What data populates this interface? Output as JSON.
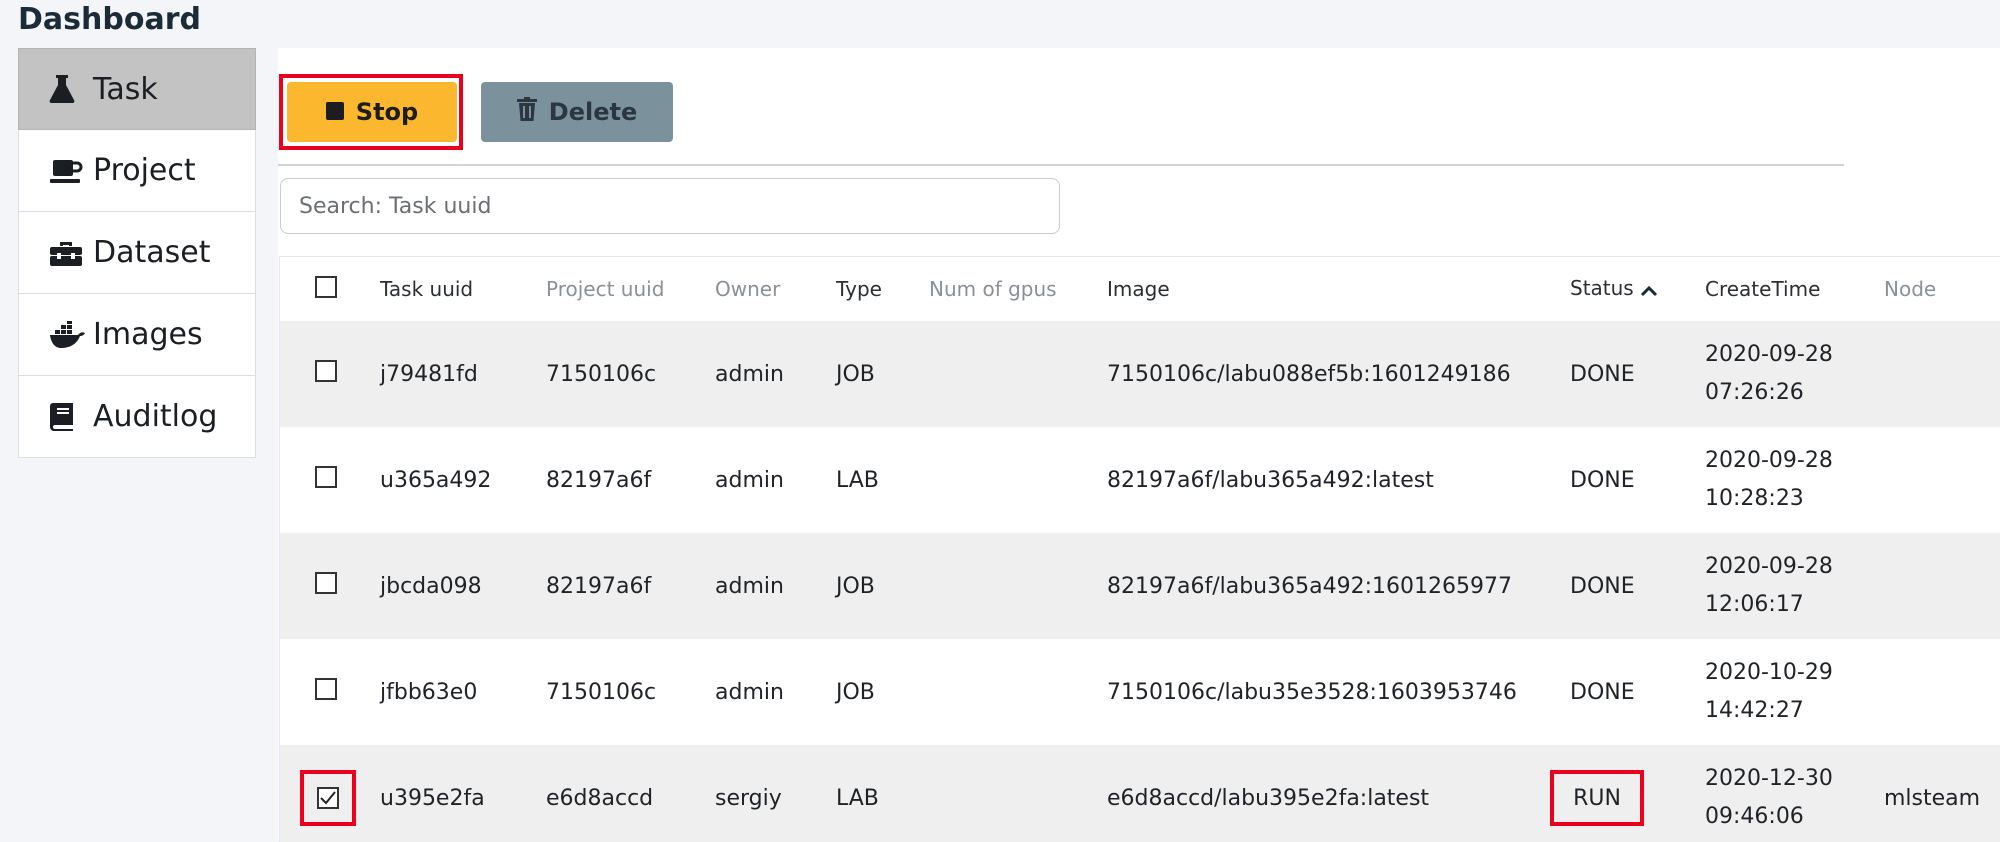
{
  "app": {
    "title": "Dashboard"
  },
  "sidebar": {
    "items": [
      {
        "label": "Task",
        "icon": "flask-icon",
        "active": true
      },
      {
        "label": "Project",
        "icon": "coffee-icon",
        "active": false
      },
      {
        "label": "Dataset",
        "icon": "toolbox-icon",
        "active": false
      },
      {
        "label": "Images",
        "icon": "docker-icon",
        "active": false
      },
      {
        "label": "Auditlog",
        "icon": "book-icon",
        "active": false
      }
    ]
  },
  "toolbar": {
    "stop_label": "Stop",
    "delete_label": "Delete",
    "search_placeholder": "Search: Task uuid",
    "search_value": ""
  },
  "table": {
    "headers": {
      "task_uuid": "Task uuid",
      "project_uuid": "Project uuid",
      "owner": "Owner",
      "type": "Type",
      "num_gpus": "Num of gpus",
      "image": "Image",
      "status": "Status",
      "create_time": "CreateTime",
      "node": "Node"
    },
    "rows": [
      {
        "checked": false,
        "task_uuid": "j79481fd",
        "project_uuid": "7150106c",
        "owner": "admin",
        "type": "JOB",
        "num_gpus": "",
        "image": "7150106c/labu088ef5b:1601249186",
        "status": "DONE",
        "date": "2020-09-28",
        "time": "07:26:26",
        "node": ""
      },
      {
        "checked": false,
        "task_uuid": "u365a492",
        "project_uuid": "82197a6f",
        "owner": "admin",
        "type": "LAB",
        "num_gpus": "",
        "image": "82197a6f/labu365a492:latest",
        "status": "DONE",
        "date": "2020-09-28",
        "time": "10:28:23",
        "node": ""
      },
      {
        "checked": false,
        "task_uuid": "jbcda098",
        "project_uuid": "82197a6f",
        "owner": "admin",
        "type": "JOB",
        "num_gpus": "",
        "image": "82197a6f/labu365a492:1601265977",
        "status": "DONE",
        "date": "2020-09-28",
        "time": "12:06:17",
        "node": ""
      },
      {
        "checked": false,
        "task_uuid": "jfbb63e0",
        "project_uuid": "7150106c",
        "owner": "admin",
        "type": "JOB",
        "num_gpus": "",
        "image": "7150106c/labu35e3528:1603953746",
        "status": "DONE",
        "date": "2020-10-29",
        "time": "14:42:27",
        "node": ""
      },
      {
        "checked": true,
        "task_uuid": "u395e2fa",
        "project_uuid": "e6d8accd",
        "owner": "sergiy",
        "type": "LAB",
        "num_gpus": "",
        "image": "e6d8accd/labu395e2fa:latest",
        "status": "RUN",
        "date": "2020-12-30",
        "time": "09:46:06",
        "node": "mlsteam"
      }
    ]
  },
  "colors": {
    "stop_button": "#fbb72d",
    "delete_button": "#7b929c",
    "highlight_red": "#e8001c",
    "active_sidebar": "#c3c3c3"
  }
}
